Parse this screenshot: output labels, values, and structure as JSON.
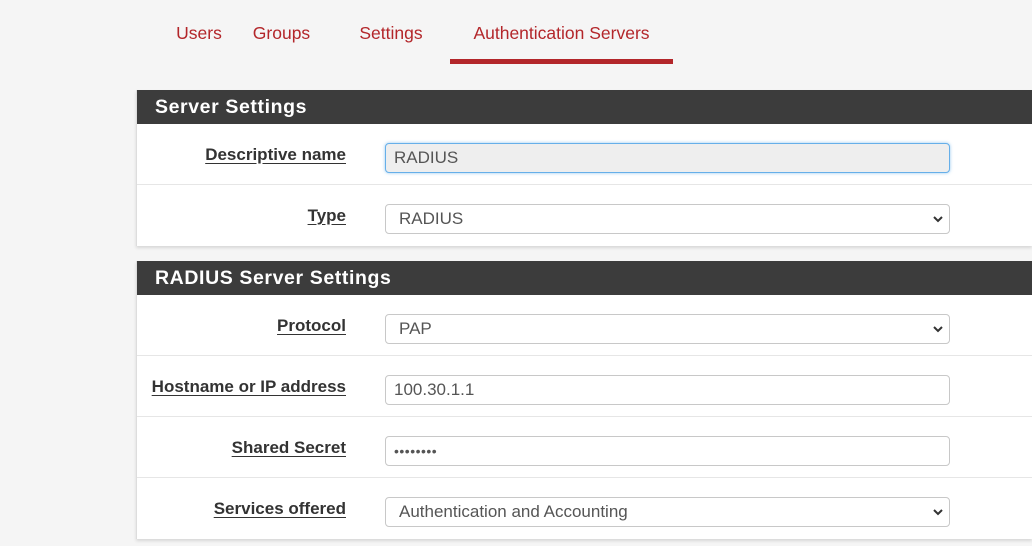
{
  "tabs": [
    {
      "label": "Users",
      "active": false
    },
    {
      "label": "Groups",
      "active": false
    },
    {
      "label": "Settings",
      "active": false
    },
    {
      "label": "Authentication Servers",
      "active": true
    }
  ],
  "server_settings": {
    "heading": "Server Settings",
    "descriptive_name": {
      "label": "Descriptive name",
      "value": "RADIUS"
    },
    "type": {
      "label": "Type",
      "value": "RADIUS"
    }
  },
  "radius_settings": {
    "heading": "RADIUS Server Settings",
    "protocol": {
      "label": "Protocol",
      "value": "PAP"
    },
    "hostname": {
      "label": "Hostname or IP address",
      "value": "100.30.1.1"
    },
    "shared_secret": {
      "label": "Shared Secret",
      "value": "••••••••"
    },
    "services": {
      "label": "Services offered",
      "value": "Authentication and Accounting"
    }
  },
  "colors": {
    "accent": "#b3262a",
    "heading_bg": "#3c3c3c",
    "focus_border": "#66afe9"
  },
  "icons": {
    "select_arrow": "chevron-down-icon"
  }
}
